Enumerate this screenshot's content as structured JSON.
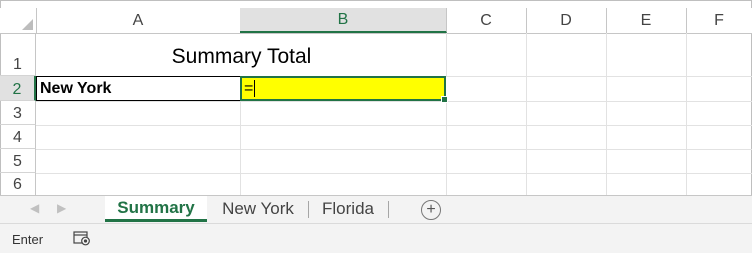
{
  "columns": [
    "A",
    "B",
    "C",
    "D",
    "E",
    "F"
  ],
  "selected_column": "B",
  "rows": [
    "1",
    "2",
    "3",
    "4",
    "5",
    "6"
  ],
  "selected_row": "2",
  "cells": {
    "title": "Summary Total",
    "a2": "New York",
    "b2": "="
  },
  "colors": {
    "accent": "#217346",
    "highlight": "#ffff00"
  },
  "sheet_tabs": [
    {
      "label": "Summary",
      "active": true
    },
    {
      "label": "New York",
      "active": false
    },
    {
      "label": "Florida",
      "active": false
    }
  ],
  "add_sheet_icon": "plus-circle-icon",
  "status": {
    "mode": "Enter",
    "macro_icon": "macro-record-icon"
  }
}
